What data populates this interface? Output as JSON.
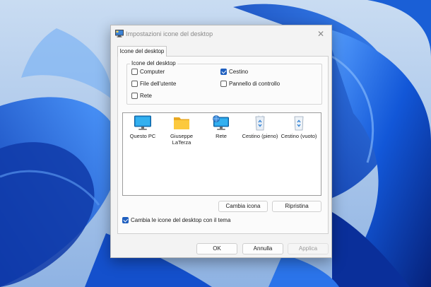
{
  "dialog": {
    "title": "Impostazioni icone del desktop",
    "close_glyph": "✕",
    "tab_label": "Icone del desktop",
    "group_title": "Icone del desktop",
    "checkboxes": [
      {
        "label": "Computer",
        "checked": false
      },
      {
        "label": "Cestino",
        "checked": true
      },
      {
        "label": "File dell'utente",
        "checked": false
      },
      {
        "label": "Pannello di controllo",
        "checked": false
      },
      {
        "label": "Rete",
        "checked": false
      }
    ],
    "icons": [
      {
        "label": "Questo PC",
        "icon": "monitor-icon"
      },
      {
        "label": "Giuseppe LaTerza",
        "icon": "folder-icon"
      },
      {
        "label": "Rete",
        "icon": "network-icon"
      },
      {
        "label": "Cestino (pieno)",
        "icon": "recycle-bin-full-icon"
      },
      {
        "label": "Cestino (vuoto)",
        "icon": "recycle-bin-empty-icon"
      }
    ],
    "change_icon_label": "Cambia icona",
    "restore_label": "Ripristina",
    "theme_checkbox": {
      "label": "Cambia le icone del desktop con il tema",
      "checked": true
    },
    "ok_label": "OK",
    "cancel_label": "Annulla",
    "apply_label": "Applica"
  },
  "colors": {
    "accent": "#1f5fbf",
    "wallpaper": "#1a5fd6"
  }
}
